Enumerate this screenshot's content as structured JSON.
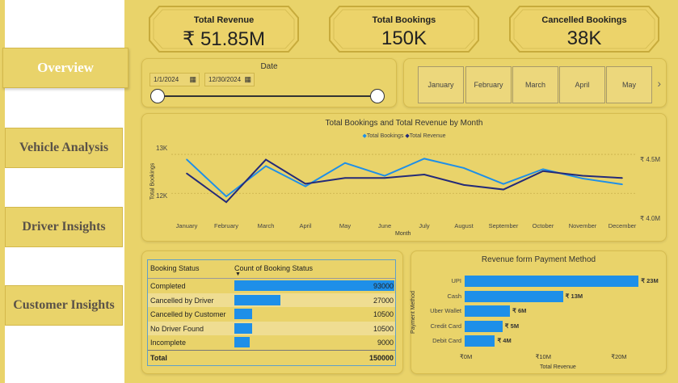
{
  "nav": {
    "items": [
      {
        "label": "Overview"
      },
      {
        "label": "Vehicle Analysis"
      },
      {
        "label": "Driver Insights"
      },
      {
        "label": "Customer Insights"
      }
    ]
  },
  "kpis": [
    {
      "title": "Total Revenue",
      "value": "₹ 51.85M"
    },
    {
      "title": "Total Bookings",
      "value": "150K"
    },
    {
      "title": "Cancelled Bookings",
      "value": "38K"
    }
  ],
  "date_slicer": {
    "title": "Date",
    "start": "1/1/2024",
    "end": "12/30/2024",
    "calendar_icon": "calendar-icon"
  },
  "month_slicer": {
    "months": [
      "January",
      "February",
      "March",
      "April",
      "May"
    ],
    "next_icon": "chevron-right-icon"
  },
  "colors": {
    "bookings": "#1e8fe8",
    "revenue": "#242a78",
    "background": "#e9d36a"
  },
  "chart_data": [
    {
      "type": "line",
      "title": "Total Bookings and Total Revenue by Month",
      "xlabel": "Month",
      "ylabel": "Total Bookings",
      "legend": "top-center",
      "categories": [
        "January",
        "February",
        "March",
        "April",
        "May",
        "June",
        "July",
        "August",
        "September",
        "October",
        "November",
        "December"
      ],
      "yticks": [
        "13K",
        "12K"
      ],
      "y2ticks": [
        "₹ 4.5M",
        "₹ 4.0M"
      ],
      "ylim": [
        11300,
        13250
      ],
      "y2lim": [
        3.98,
        4.64
      ],
      "series": [
        {
          "name": "Total Bookings",
          "axis": "left",
          "values": [
            12870,
            11920,
            12700,
            12180,
            12780,
            12450,
            12890,
            12650,
            12240,
            12620,
            12380,
            12230
          ]
        },
        {
          "name": "Total Revenue",
          "axis": "right",
          "values": [
            4.39,
            4.14,
            4.51,
            4.3,
            4.35,
            4.35,
            4.38,
            4.29,
            4.25,
            4.41,
            4.37,
            4.35
          ]
        }
      ]
    },
    {
      "type": "table",
      "headers": [
        "Booking Status",
        "Count of Booking Status"
      ],
      "rows": [
        {
          "label": "Completed",
          "value": 93000,
          "display": "93000"
        },
        {
          "label": "Cancelled by Driver",
          "value": 27000,
          "display": "27000"
        },
        {
          "label": "Cancelled by Customer",
          "value": 10500,
          "display": "10500"
        },
        {
          "label": "No Driver Found",
          "value": 10500,
          "display": "10500"
        },
        {
          "label": "Incomplete",
          "value": 9000,
          "display": "9000"
        }
      ],
      "total": {
        "label": "Total",
        "display": "150000"
      }
    },
    {
      "type": "bar",
      "orientation": "horizontal",
      "title": "Revenue form Payment Method",
      "xlabel": "Total Revenue",
      "ylabel": "Payment Method",
      "xlim": [
        0,
        25
      ],
      "xticks": [
        "₹0M",
        "₹10M",
        "₹20M"
      ],
      "categories": [
        "UPI",
        "Cash",
        "Uber Wallet",
        "Credit Card",
        "Debit Card"
      ],
      "values": [
        23,
        13,
        6,
        5,
        4
      ],
      "labels": [
        "₹ 23M",
        "₹ 13M",
        "₹ 6M",
        "₹ 5M",
        "₹ 4M"
      ]
    }
  ]
}
